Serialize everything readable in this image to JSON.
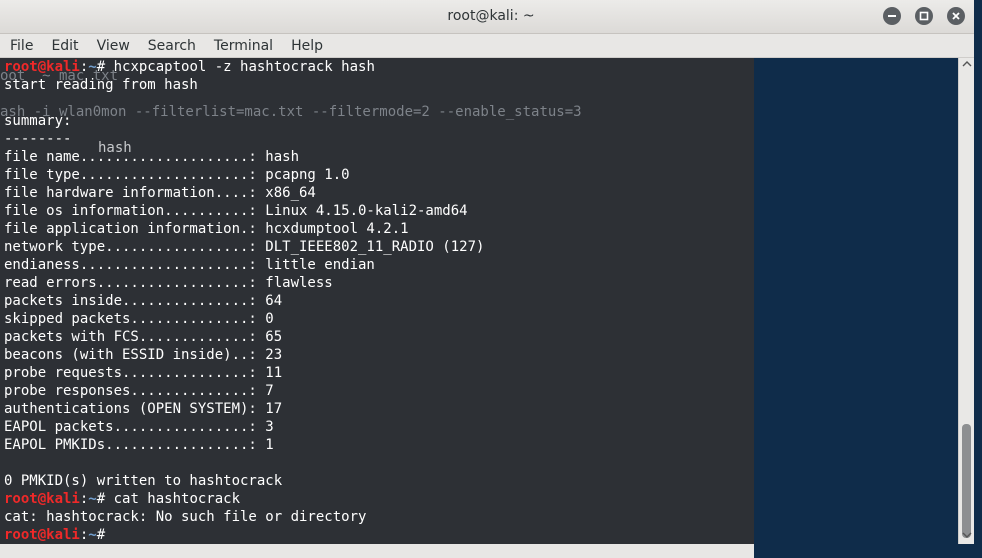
{
  "window": {
    "title": "root@kali: ~"
  },
  "menu": [
    "File",
    "Edit",
    "View",
    "Search",
    "Terminal",
    "Help"
  ],
  "prompt": {
    "user_host": "root@kali",
    "sep": ":",
    "path": "~",
    "symbol": "# "
  },
  "ghost_lines": [
    "oot  ~ mac txt",
    "ash -i wlan0mon --filterlist=mac.txt --filtermode=2 --enable_status=3",
    "hash"
  ],
  "lines": [
    {
      "type": "prompt",
      "cmd": "hcxpcaptool -z hashtocrack hash"
    },
    {
      "type": "text",
      "text": "start reading from hash"
    },
    {
      "type": "text",
      "text": ""
    },
    {
      "type": "text",
      "text": "summary:"
    },
    {
      "type": "text",
      "text": "--------"
    },
    {
      "type": "text",
      "text": "file name....................: hash"
    },
    {
      "type": "text",
      "text": "file type....................: pcapng 1.0"
    },
    {
      "type": "text",
      "text": "file hardware information....: x86_64"
    },
    {
      "type": "text",
      "text": "file os information..........: Linux 4.15.0-kali2-amd64"
    },
    {
      "type": "text",
      "text": "file application information.: hcxdumptool 4.2.1"
    },
    {
      "type": "text",
      "text": "network type.................: DLT_IEEE802_11_RADIO (127)"
    },
    {
      "type": "text",
      "text": "endianess....................: little endian"
    },
    {
      "type": "text",
      "text": "read errors..................: flawless"
    },
    {
      "type": "text",
      "text": "packets inside...............: 64"
    },
    {
      "type": "text",
      "text": "skipped packets..............: 0"
    },
    {
      "type": "text",
      "text": "packets with FCS.............: 65"
    },
    {
      "type": "text",
      "text": "beacons (with ESSID inside)..: 23"
    },
    {
      "type": "text",
      "text": "probe requests...............: 11"
    },
    {
      "type": "text",
      "text": "probe responses..............: 7"
    },
    {
      "type": "text",
      "text": "authentications (OPEN SYSTEM): 17"
    },
    {
      "type": "text",
      "text": "EAPOL packets................: 3"
    },
    {
      "type": "text",
      "text": "EAPOL PMKIDs.................: 1"
    },
    {
      "type": "text",
      "text": ""
    },
    {
      "type": "text",
      "text": "0 PMKID(s) written to hashtocrack"
    },
    {
      "type": "prompt",
      "cmd": "cat hashtocrack"
    },
    {
      "type": "text",
      "text": "cat: hashtocrack: No such file or directory"
    },
    {
      "type": "prompt",
      "cmd": ""
    }
  ]
}
